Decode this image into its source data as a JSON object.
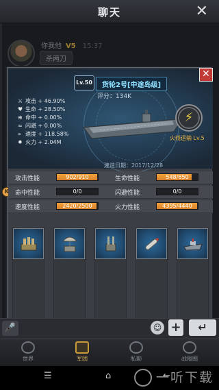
{
  "chat": {
    "title": "聊天",
    "close_icon": "close-icon",
    "message": {
      "sender": "你我他",
      "rank": "V5",
      "time": "15:37",
      "text": "杀两刀"
    }
  },
  "dialog": {
    "level": "Lv.50",
    "ship_name": "货轮2号[中途岛级]",
    "rating": "评分：134K",
    "build_date": "建造日期：2017/12/28",
    "close_label": "✕",
    "skill": {
      "name": "火线运输 Lv.5",
      "icon": "lightning-icon"
    },
    "bonuses": [
      {
        "icon": "sword-icon",
        "label": "攻击",
        "value": "+ 46.90%"
      },
      {
        "icon": "heart-icon",
        "label": "生命",
        "value": "+ 28.50%"
      },
      {
        "icon": "crosshair-icon",
        "label": "命中",
        "value": "+ 0.00%"
      },
      {
        "icon": "dodge-icon",
        "label": "闪避",
        "value": "+ 0.00%"
      },
      {
        "icon": "speed-icon",
        "label": "速度",
        "value": "+ 118.58%"
      },
      {
        "icon": "firepower-icon",
        "label": "火力",
        "value": "+ 2.04M"
      }
    ],
    "stats": [
      {
        "label": "攻击性能",
        "value": "902/910",
        "fraction": 0.9912
      },
      {
        "label": "生命性能",
        "value": "548/650",
        "fraction": 0.843
      },
      {
        "label": "命中性能",
        "value": "0/0",
        "fraction": 0
      },
      {
        "label": "闪避性能",
        "value": "0/0",
        "fraction": 0
      },
      {
        "label": "速度性能",
        "value": "2420/2500",
        "fraction": 0.968
      },
      {
        "label": "火力性能",
        "value": "4395/4440",
        "fraction": 0.9899
      }
    ],
    "side_tab": "K",
    "equipment": [
      "cannon-equipment",
      "radar-equipment",
      "aa-gun-equipment",
      "torpedo-equipment",
      "battleship-equipment"
    ]
  },
  "input": {
    "mic": "🎤",
    "emoji": "☺",
    "plus": "+",
    "send": "↵"
  },
  "nav": [
    {
      "label": "世界",
      "icon": "globe-icon",
      "active": false
    },
    {
      "label": "军团",
      "icon": "legion-icon",
      "active": true
    },
    {
      "label": "私聊",
      "icon": "private-chat-icon",
      "active": false
    },
    {
      "label": "战报圈",
      "icon": "battle-report-icon",
      "active": false
    }
  ],
  "system": {
    "menu": "☰",
    "home": "⌂",
    "back": "←"
  },
  "watermark": "一听下载",
  "colors": {
    "accent_orange": "#e8942f",
    "skill_orange": "#f6b63f",
    "ship_name_cyan": "#8fe0ff",
    "close_red": "#c23b36"
  }
}
